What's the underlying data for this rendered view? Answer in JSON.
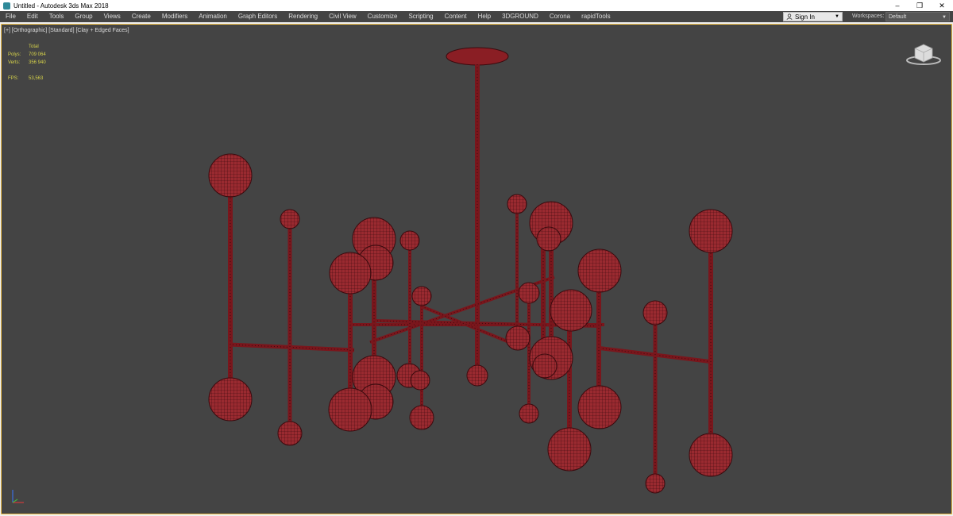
{
  "window": {
    "title": "Untitled - Autodesk 3ds Max 2018",
    "controls": {
      "minimize": "–",
      "maximize": "❐",
      "close": "✕"
    }
  },
  "menu": {
    "items": [
      "File",
      "Edit",
      "Tools",
      "Group",
      "Views",
      "Create",
      "Modifiers",
      "Animation",
      "Graph Editors",
      "Rendering",
      "Civil View",
      "Customize",
      "Scripting",
      "Content",
      "Help",
      "3DGROUND",
      "Corona",
      "rapidTools"
    ]
  },
  "signin": {
    "label": "Sign In"
  },
  "workspaces": {
    "label": "Workspaces:",
    "value": "Default"
  },
  "viewport": {
    "label": "[+] [Orthographic] [Standard] [Clay + Edged Faces]",
    "stats": {
      "header": "Total",
      "polys_label": "Polys:",
      "polys_value": "709 064",
      "verts_label": "Verts:",
      "verts_value": "356 940",
      "fps_label": "FPS:",
      "fps_value": "53,563"
    },
    "border_color": "#f1c14b",
    "background": "#444444",
    "model_color": "#8a1e24"
  },
  "icons": [
    "app-icon",
    "user-icon",
    "viewcube-icon",
    "axis-tripod-icon"
  ]
}
